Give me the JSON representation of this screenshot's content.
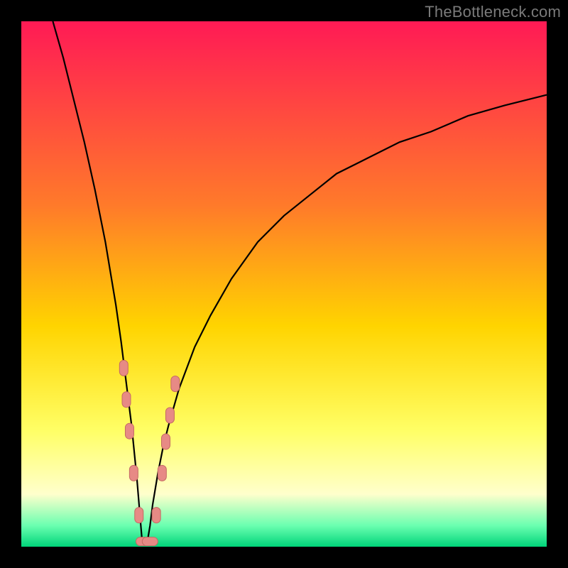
{
  "watermark": "TheBottleneck.com",
  "colors": {
    "frame": "#000000",
    "grad_top": "#ff1a55",
    "grad_mid1": "#ff7a2a",
    "grad_mid2": "#ffd400",
    "grad_mid3": "#ffff66",
    "grad_bottom_yellow": "#ffffcc",
    "grad_green_light": "#6affb0",
    "grad_green": "#00d47a",
    "curve": "#000000",
    "marker_fill": "#e78a85",
    "marker_stroke": "#c46a63"
  },
  "chart_data": {
    "type": "line",
    "title": "",
    "xlabel": "",
    "ylabel": "",
    "xlim": [
      0,
      100
    ],
    "ylim": [
      0,
      100
    ],
    "note": "Bottleneck-shaped curve. Sharp V-notch minimum near x≈23–24. Values estimated from pixels (axes unlabeled, interpreted as 0–100).",
    "series": [
      {
        "name": "curve",
        "x": [
          6,
          8,
          10,
          12,
          14,
          16,
          18,
          19,
          20,
          21,
          22,
          22.5,
          23,
          23.5,
          24,
          24.5,
          25,
          26,
          27,
          28,
          30,
          33,
          36,
          40,
          45,
          50,
          55,
          60,
          66,
          72,
          78,
          85,
          92,
          100
        ],
        "y": [
          100,
          93,
          85,
          77,
          68,
          58,
          46,
          39,
          31,
          23,
          13,
          7,
          1,
          0.5,
          1,
          4,
          8,
          14,
          19,
          23,
          30,
          38,
          44,
          51,
          58,
          63,
          67,
          71,
          74,
          77,
          79,
          82,
          84,
          86
        ]
      }
    ],
    "markers": [
      {
        "x": 19.5,
        "y": 34,
        "shape": "vcapsule"
      },
      {
        "x": 20.0,
        "y": 28,
        "shape": "vcapsule"
      },
      {
        "x": 20.6,
        "y": 22,
        "shape": "vcapsule"
      },
      {
        "x": 21.4,
        "y": 14,
        "shape": "vcapsule"
      },
      {
        "x": 22.4,
        "y": 6,
        "shape": "vcapsule"
      },
      {
        "x": 23.3,
        "y": 1,
        "shape": "hcapsule"
      },
      {
        "x": 24.5,
        "y": 1,
        "shape": "hcapsule"
      },
      {
        "x": 25.7,
        "y": 6,
        "shape": "vcapsule"
      },
      {
        "x": 26.8,
        "y": 14,
        "shape": "vcapsule"
      },
      {
        "x": 27.5,
        "y": 20,
        "shape": "vcapsule"
      },
      {
        "x": 28.3,
        "y": 25,
        "shape": "vcapsule"
      },
      {
        "x": 29.3,
        "y": 31,
        "shape": "vcapsule"
      }
    ]
  }
}
